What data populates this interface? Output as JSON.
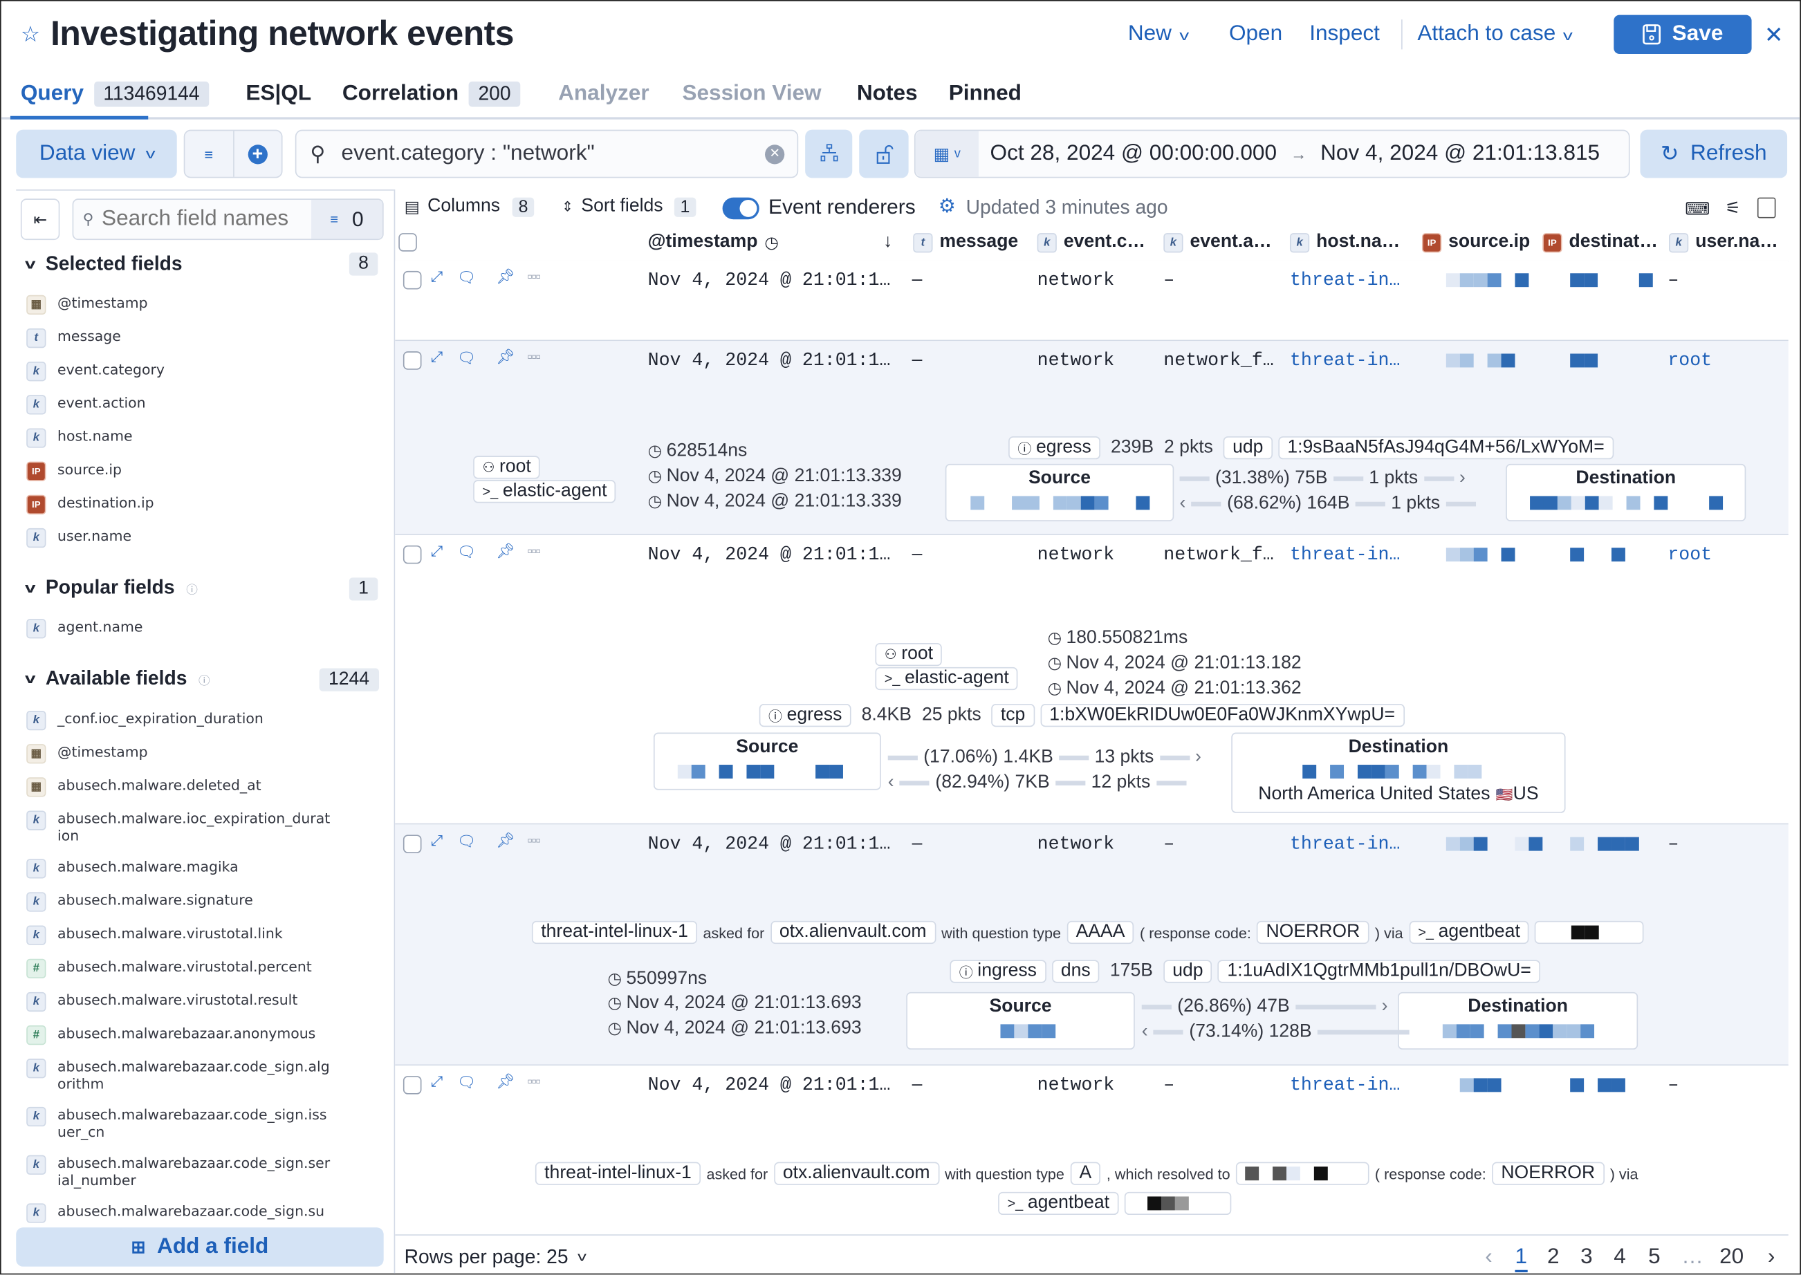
{
  "header": {
    "title": "Investigating network events",
    "actions": {
      "new": "New",
      "open": "Open",
      "inspect": "Inspect",
      "attach": "Attach to case",
      "save": "Save"
    }
  },
  "tabs": [
    {
      "label": "Query",
      "badge": "113469144",
      "active": true
    },
    {
      "label": "ES|QL"
    },
    {
      "label": "Correlation",
      "badge": "200"
    },
    {
      "label": "Analyzer",
      "disabled": true
    },
    {
      "label": "Session View",
      "disabled": true
    },
    {
      "label": "Notes"
    },
    {
      "label": "Pinned"
    }
  ],
  "query_bar": {
    "data_view": "Data view",
    "query": "event.category : \"network\"",
    "date_start": "Oct 28, 2024 @ 00:00:00.000",
    "date_end": "Nov 4, 2024 @ 21:01:13.815",
    "refresh": "Refresh"
  },
  "sidebar": {
    "search_placeholder": "Search field names",
    "filter_count": "0",
    "selected": {
      "title": "Selected fields",
      "count": "8",
      "fields": [
        {
          "name": "@timestamp",
          "type": "date"
        },
        {
          "name": "message",
          "type": "t"
        },
        {
          "name": "event.category",
          "type": "k"
        },
        {
          "name": "event.action",
          "type": "k"
        },
        {
          "name": "host.name",
          "type": "k"
        },
        {
          "name": "source.ip",
          "type": "ip"
        },
        {
          "name": "destination.ip",
          "type": "ip"
        },
        {
          "name": "user.name",
          "type": "k"
        }
      ]
    },
    "popular": {
      "title": "Popular fields",
      "count": "1",
      "fields": [
        {
          "name": "agent.name",
          "type": "k"
        }
      ]
    },
    "available": {
      "title": "Available fields",
      "count": "1244",
      "fields": [
        {
          "name": "_conf.ioc_expiration_duration",
          "type": "k"
        },
        {
          "name": "@timestamp",
          "type": "date"
        },
        {
          "name": "abusech.malware.deleted_at",
          "type": "date"
        },
        {
          "name": "abusech.malware.ioc_expiration_duration",
          "type": "k"
        },
        {
          "name": "abusech.malware.magika",
          "type": "k"
        },
        {
          "name": "abusech.malware.signature",
          "type": "k"
        },
        {
          "name": "abusech.malware.virustotal.link",
          "type": "k"
        },
        {
          "name": "abusech.malware.virustotal.percent",
          "type": "num"
        },
        {
          "name": "abusech.malware.virustotal.result",
          "type": "k"
        },
        {
          "name": "abusech.malwarebazaar.anonymous",
          "type": "num"
        },
        {
          "name": "abusech.malwarebazaar.code_sign.algorithm",
          "type": "k"
        },
        {
          "name": "abusech.malwarebazaar.code_sign.issuer_cn",
          "type": "k"
        },
        {
          "name": "abusech.malwarebazaar.code_sign.serial_number",
          "type": "k"
        },
        {
          "name": "abusech.malwarebazaar.code_sign.su",
          "type": "k"
        }
      ]
    },
    "add_field": "Add a field"
  },
  "grid": {
    "toolbar": {
      "columns": "Columns",
      "columns_count": "8",
      "sort": "Sort fields",
      "sort_count": "1",
      "event_renderers": "Event renderers",
      "event_renderers_enabled": true,
      "updated": "Updated 3 minutes ago"
    },
    "columns": [
      {
        "label": "@timestamp",
        "type": "",
        "sorted": "desc"
      },
      {
        "label": "message",
        "type": "t"
      },
      {
        "label": "event.c…",
        "type": "k"
      },
      {
        "label": "event.a…",
        "type": "k"
      },
      {
        "label": "host.na…",
        "type": "k"
      },
      {
        "label": "source.ip",
        "type": "ip"
      },
      {
        "label": "destinat…",
        "type": "ip"
      },
      {
        "label": "user.na…",
        "type": "k"
      }
    ],
    "rows": [
      {
        "timestamp": "Nov 4, 2024 @ 21:01:1…",
        "message": "–",
        "category": "network",
        "action": "–",
        "host": "threat-in…",
        "user": "–"
      },
      {
        "timestamp": "Nov 4, 2024 @ 21:01:1…",
        "message": "–",
        "category": "network",
        "action": "network_f…",
        "host": "threat-in…",
        "user": "root"
      },
      {
        "timestamp": "Nov 4, 2024 @ 21:01:1…",
        "message": "–",
        "category": "network",
        "action": "network_f…",
        "host": "threat-in…",
        "user": "root"
      },
      {
        "timestamp": "Nov 4, 2024 @ 21:01:1…",
        "message": "–",
        "category": "network",
        "action": "–",
        "host": "threat-in…",
        "user": "–"
      },
      {
        "timestamp": "Nov 4, 2024 @ 21:01:1…",
        "message": "–",
        "category": "network",
        "action": "–",
        "host": "threat-in…",
        "user": "–"
      }
    ],
    "renderers": {
      "row2": {
        "user": "root",
        "process": "elastic-agent",
        "duration": "628514ns",
        "start": "Nov 4, 2024 @ 21:01:13.339",
        "end": "Nov 4, 2024 @ 21:01:13.339",
        "direction": "egress",
        "bytes": "239B",
        "packets": "2 pkts",
        "transport": "udp",
        "community_id": "1:9sBaaN5fAsJ94qG4M+56/LxWYoM=",
        "source_label": "Source",
        "destination_label": "Destination",
        "out": {
          "pct": "(31.38%) 75B",
          "pkts": "1 pkts"
        },
        "in": {
          "pct": "(68.62%) 164B",
          "pkts": "1 pkts"
        }
      },
      "row3": {
        "user": "root",
        "process": "elastic-agent",
        "duration": "180.550821ms",
        "start": "Nov 4, 2024 @ 21:01:13.182",
        "end": "Nov 4, 2024 @ 21:01:13.362",
        "direction": "egress",
        "bytes": "8.4KB",
        "packets": "25 pkts",
        "transport": "tcp",
        "community_id": "1:bXW0EkRIDUw0E0Fa0WJKnmXYwpU=",
        "source_label": "Source",
        "destination_label": "Destination",
        "destination_geo": "North America United States",
        "destination_country": "US",
        "out": {
          "pct": "(17.06%) 1.4KB",
          "pkts": "13 pkts"
        },
        "in": {
          "pct": "(82.94%) 7KB",
          "pkts": "12 pkts"
        }
      },
      "row4": {
        "host": "threat-intel-linux-1",
        "asked_for": "asked for",
        "question_name": "otx.alienvault.com",
        "with_type": "with question type",
        "question_type": "AAAA",
        "response_label": "( response code:",
        "response_code": "NOERROR",
        "via": ") via",
        "agent": "agentbeat",
        "direction": "ingress",
        "protocol": "dns",
        "bytes": "175B",
        "transport": "udp",
        "community_id": "1:1uAdIX1QgtrMMb1pull1n/DBOwU=",
        "duration": "550997ns",
        "start": "Nov 4, 2024 @ 21:01:13.693",
        "end": "Nov 4, 2024 @ 21:01:13.693",
        "source_label": "Source",
        "destination_label": "Destination",
        "out": {
          "pct": "(26.86%) 47B"
        },
        "in": {
          "pct": "(73.14%) 128B"
        }
      },
      "row5": {
        "host": "threat-intel-linux-1",
        "asked_for": "asked for",
        "question_name": "otx.alienvault.com",
        "with_type": "with question type",
        "question_type": "A",
        "resolved": ", which resolved to",
        "response_label": "( response code:",
        "response_code": "NOERROR",
        "via": ") via",
        "agent": "agentbeat"
      }
    }
  },
  "footer": {
    "rows_per_page": "Rows per page: 25",
    "pages": [
      "1",
      "2",
      "3",
      "4",
      "5",
      "…",
      "20"
    ],
    "current_page": "1"
  },
  "colors": {
    "accent": "#2e72c9",
    "link": "#1d5fb8",
    "row_alt": "#f1f4fa",
    "border": "#d3dae6"
  }
}
